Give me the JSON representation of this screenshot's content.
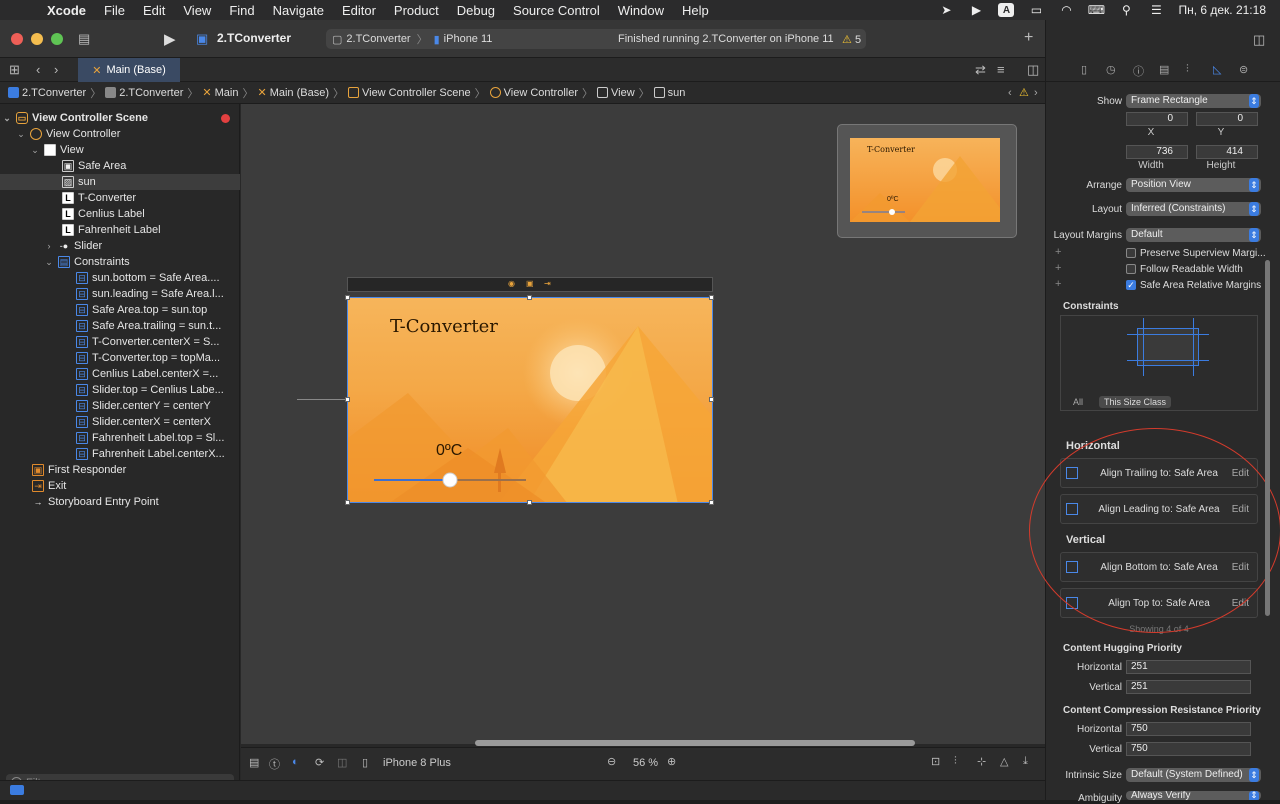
{
  "menubar": {
    "app": "Xcode",
    "items": [
      "File",
      "Edit",
      "View",
      "Find",
      "Navigate",
      "Editor",
      "Product",
      "Debug",
      "Source Control",
      "Window",
      "Help"
    ],
    "status_a_label": "A",
    "clock": "Пн, 6 дек.  21:18"
  },
  "toolbar": {
    "scheme_name": "2.TConverter",
    "target": "2.TConverter",
    "device": "iPhone 11",
    "status": "Finished running 2.TConverter on iPhone 11",
    "warnings": "5"
  },
  "tabbar": {
    "active_tab": "Main (Base)"
  },
  "jumpbar": {
    "crumbs": [
      "2.TConverter",
      "2.TConverter",
      "Main",
      "Main (Base)",
      "View Controller Scene",
      "View Controller",
      "View",
      "sun"
    ]
  },
  "navigator": {
    "rows": [
      {
        "label": "View Controller Scene"
      },
      {
        "label": "View Controller"
      },
      {
        "label": "View"
      },
      {
        "label": "Safe Area"
      },
      {
        "label": "sun"
      },
      {
        "label": "T-Converter"
      },
      {
        "label": "Cenlius Label"
      },
      {
        "label": "Fahrenheit Label"
      },
      {
        "label": "Slider"
      },
      {
        "label": "Constraints"
      },
      {
        "label": "sun.bottom = Safe Area...."
      },
      {
        "label": "sun.leading = Safe Area.l..."
      },
      {
        "label": "Safe Area.top = sun.top"
      },
      {
        "label": "Safe Area.trailing = sun.t..."
      },
      {
        "label": "T-Converter.centerX = S..."
      },
      {
        "label": "T-Converter.top = topMa..."
      },
      {
        "label": "Cenlius Label.centerX =..."
      },
      {
        "label": "Slider.top = Cenlius Labe..."
      },
      {
        "label": "Slider.centerY = centerY"
      },
      {
        "label": "Slider.centerX = centerX"
      },
      {
        "label": "Fahrenheit Label.top = Sl..."
      },
      {
        "label": "Fahrenheit Label.centerX..."
      },
      {
        "label": "First Responder"
      },
      {
        "label": "Exit"
      },
      {
        "label": "Storyboard Entry Point"
      }
    ],
    "filter_placeholder": "Filter"
  },
  "canvas": {
    "app_title": "T-Converter",
    "temp_label": "0ºC",
    "temp_label_mini": "0ºC",
    "device": "iPhone 8 Plus",
    "zoom": "56 %"
  },
  "inspector": {
    "show_label": "Show",
    "show_value": "Frame Rectangle",
    "x_value": "0",
    "y_value": "0",
    "x_label": "X",
    "y_label": "Y",
    "width_value": "736",
    "height_value": "414",
    "width_label": "Width",
    "height_label": "Height",
    "arrange_label": "Arrange",
    "arrange_value": "Position View",
    "layout_label": "Layout",
    "layout_value": "Inferred (Constraints)",
    "margins_label": "Layout Margins",
    "margins_value": "Default",
    "preserve_label": "Preserve Superview Margi...",
    "readable_label": "Follow Readable Width",
    "safearea_label": "Safe Area Relative Margins",
    "constraints_title": "Constraints",
    "seg_all": "All",
    "seg_class": "This Size Class",
    "horizontal_title": "Horizontal",
    "vertical_title": "Vertical",
    "constraints": [
      {
        "text": "Align Trailing to:  Safe Area",
        "edit": "Edit"
      },
      {
        "text": "Align Leading to:  Safe Area",
        "edit": "Edit"
      },
      {
        "text": "Align Bottom to:  Safe Area",
        "edit": "Edit"
      },
      {
        "text": "Align Top to:  Safe Area",
        "edit": "Edit"
      }
    ],
    "showing": "Showing 4 of 4",
    "hugging_title": "Content Hugging Priority",
    "hug_h_label": "Horizontal",
    "hug_h_value": "251",
    "hug_v_label": "Vertical",
    "hug_v_value": "251",
    "compression_title": "Content Compression Resistance Priority",
    "comp_h_label": "Horizontal",
    "comp_h_value": "750",
    "comp_v_label": "Vertical",
    "comp_v_value": "750",
    "intrinsic_label": "Intrinsic Size",
    "intrinsic_value": "Default (System Defined)",
    "ambiguity_label": "Ambiguity",
    "ambiguity_value": "Always Verify"
  }
}
